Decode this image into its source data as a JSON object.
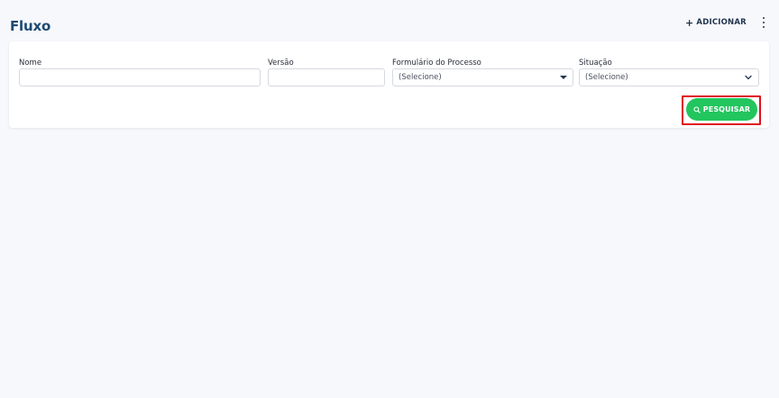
{
  "header": {
    "title": "Fluxo",
    "add_label": "ADICIONAR",
    "add_symbol": "+",
    "more_icon": "kebab-menu-icon"
  },
  "filters": {
    "name": {
      "label": "Nome",
      "value": ""
    },
    "version": {
      "label": "Versão",
      "value": ""
    },
    "process_form": {
      "label": "Formulário do Processo",
      "selected": "(Selecione)",
      "icon": "caret-down-icon"
    },
    "situation": {
      "label": "Situação",
      "selected": "(Selecione)",
      "icon": "chevron-down-icon"
    }
  },
  "actions": {
    "search_label": "PESQUISAR",
    "search_icon": "search-icon",
    "search_color": "#22c55e",
    "highlight_color": "#e0111b"
  }
}
